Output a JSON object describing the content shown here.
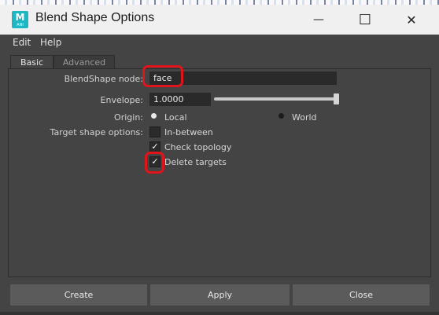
{
  "window": {
    "title": "Blend Shape Options",
    "app_icon_letter": "M",
    "app_icon_sub": "ANI",
    "minimize_glyph": "—",
    "maximize_glyph": "☐",
    "close_glyph": "✕"
  },
  "menu": {
    "items": [
      "Edit",
      "Help"
    ]
  },
  "tabs": [
    {
      "label": "Basic",
      "active": true
    },
    {
      "label": "Advanced",
      "active": false
    }
  ],
  "form": {
    "blendshape_node_label": "BlendShape node:",
    "blendshape_node_value": "face",
    "envelope_label": "Envelope:",
    "envelope_value": "1.0000",
    "envelope_fraction": 1.0,
    "origin_label": "Origin:",
    "origin_options": [
      "Local",
      "World"
    ],
    "origin_selected": "Local",
    "target_options_label": "Target shape options:",
    "checkboxes": [
      {
        "label": "In-between",
        "checked": false,
        "check_glyph": ""
      },
      {
        "label": "Check topology",
        "checked": true,
        "check_glyph": "✓"
      },
      {
        "label": "Delete targets",
        "checked": true,
        "check_glyph": "✓"
      }
    ]
  },
  "buttons": {
    "create": "Create",
    "apply": "Apply",
    "close": "Close"
  },
  "colors": {
    "background": "#444444",
    "field": "#2a2a2a",
    "button": "#5b5b5b",
    "annotation": "#e0151b",
    "app_icon": "#1db6c2"
  }
}
